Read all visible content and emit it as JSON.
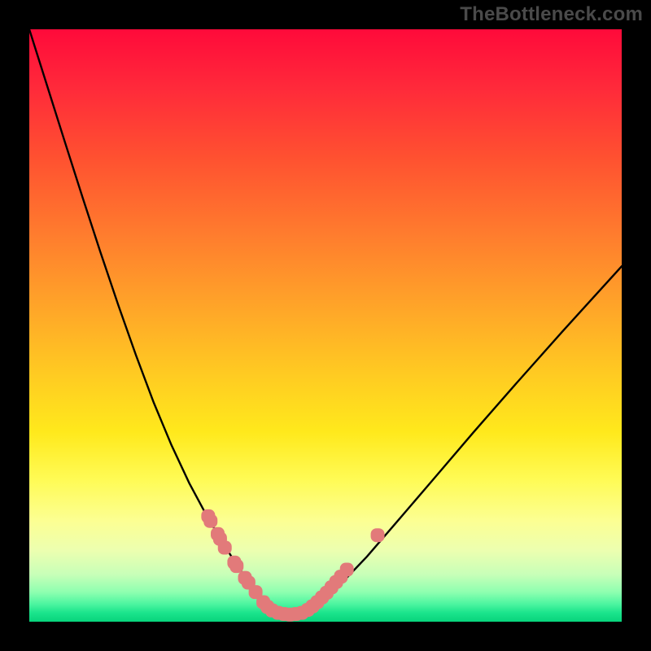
{
  "watermark": "TheBottleneck.com",
  "colors": {
    "background_frame": "#000000",
    "curve": "#000000",
    "marker_fill": "#e27a7a",
    "marker_stroke": "#c85f5f",
    "gradient_top": "#ff0a3a",
    "gradient_bottom": "#08d47c"
  },
  "chart_data": {
    "type": "line",
    "title": "",
    "xlabel": "",
    "ylabel": "",
    "xlim": [
      0,
      100
    ],
    "ylim": [
      0,
      100
    ],
    "grid": false,
    "legend": false,
    "annotations": [
      "TheBottleneck.com"
    ],
    "series": [
      {
        "name": "bottleneck-curve",
        "x": [
          0,
          3,
          6,
          9,
          12,
          15,
          18,
          21,
          24,
          27,
          30,
          33,
          34.5,
          36,
          37.5,
          38.5,
          39.5,
          40.5,
          42,
          44,
          46,
          48,
          50,
          53,
          57,
          62,
          68,
          75,
          82,
          90,
          100
        ],
        "values": [
          100,
          90.5,
          81,
          71.6,
          62.4,
          53.5,
          45,
          37,
          29.8,
          23.4,
          17.8,
          12.8,
          10.4,
          8.2,
          6.2,
          4.6,
          3.2,
          2.2,
          1.4,
          1.2,
          1.4,
          2.4,
          4,
          6.8,
          11,
          16.8,
          23.8,
          32,
          40,
          49,
          60
        ]
      }
    ],
    "markers": [
      {
        "name": "left-cluster",
        "shape": "rounded-square",
        "points": [
          {
            "x": 30.2,
            "y": 17.8
          },
          {
            "x": 30.6,
            "y": 17.0
          },
          {
            "x": 31.8,
            "y": 14.8
          },
          {
            "x": 32.2,
            "y": 14.0
          },
          {
            "x": 33.0,
            "y": 12.5
          },
          {
            "x": 34.6,
            "y": 10.0
          },
          {
            "x": 35.0,
            "y": 9.4
          },
          {
            "x": 36.4,
            "y": 7.4
          },
          {
            "x": 37.0,
            "y": 6.6
          },
          {
            "x": 38.2,
            "y": 5.0
          }
        ]
      },
      {
        "name": "bottom-cluster",
        "shape": "rounded-square",
        "points": [
          {
            "x": 39.5,
            "y": 3.3
          },
          {
            "x": 40.2,
            "y": 2.5
          },
          {
            "x": 41.0,
            "y": 1.9
          },
          {
            "x": 42.0,
            "y": 1.5
          },
          {
            "x": 43.0,
            "y": 1.3
          },
          {
            "x": 44.0,
            "y": 1.2
          },
          {
            "x": 45.0,
            "y": 1.3
          },
          {
            "x": 46.0,
            "y": 1.5
          },
          {
            "x": 47.0,
            "y": 2.0
          }
        ]
      },
      {
        "name": "right-cluster",
        "shape": "rounded-square",
        "points": [
          {
            "x": 47.8,
            "y": 2.6
          },
          {
            "x": 48.6,
            "y": 3.3
          },
          {
            "x": 49.4,
            "y": 4.1
          },
          {
            "x": 50.2,
            "y": 4.9
          },
          {
            "x": 51.0,
            "y": 5.8
          },
          {
            "x": 51.8,
            "y": 6.7
          },
          {
            "x": 52.6,
            "y": 7.6
          },
          {
            "x": 53.6,
            "y": 8.8
          }
        ]
      },
      {
        "name": "right-outlier",
        "shape": "rounded-square",
        "points": [
          {
            "x": 58.8,
            "y": 14.6
          }
        ]
      }
    ]
  }
}
